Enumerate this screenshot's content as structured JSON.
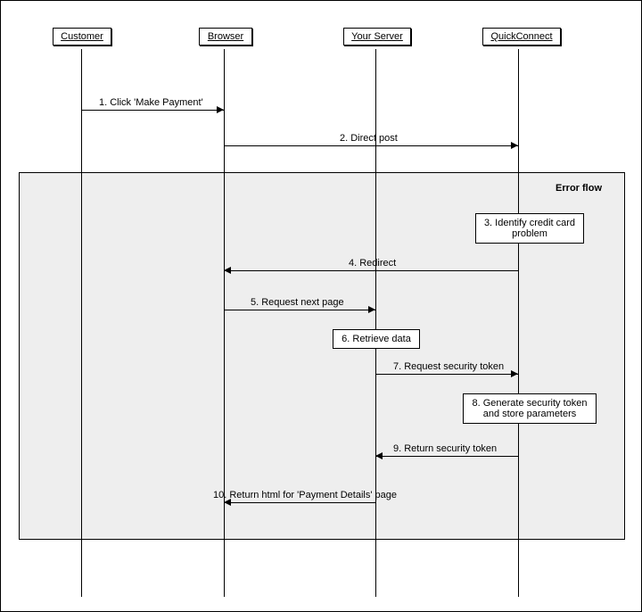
{
  "actors": {
    "customer": "Customer",
    "browser": "Browser",
    "server": "Your Server",
    "quickconnect": "QuickConnect"
  },
  "error_flow_label": "Error flow",
  "messages": {
    "m1": "1. Click 'Make Payment'",
    "m2": "2. Direct post",
    "m4": "4. Redirect",
    "m5": "5. Request next page",
    "m7": "7. Request security token",
    "m9": "9. Return security token",
    "m10": "10. Return html for 'Payment Details' page"
  },
  "notes": {
    "n3": "3. Identify credit card problem",
    "n6": "6. Retrieve data",
    "n8": "8. Generate security token and store parameters"
  },
  "chart_data": {
    "type": "sequence-diagram",
    "participants": [
      "Customer",
      "Browser",
      "Your Server",
      "QuickConnect"
    ],
    "fragments": [
      {
        "type": "box",
        "label": "Error flow",
        "contains_steps": [
          3,
          4,
          5,
          6,
          7,
          8,
          9,
          10
        ]
      }
    ],
    "steps": [
      {
        "n": 1,
        "from": "Customer",
        "to": "Browser",
        "text": "Click 'Make Payment'",
        "kind": "message"
      },
      {
        "n": 2,
        "from": "Browser",
        "to": "QuickConnect",
        "text": "Direct post",
        "kind": "message"
      },
      {
        "n": 3,
        "at": "QuickConnect",
        "text": "Identify credit card problem",
        "kind": "self-action"
      },
      {
        "n": 4,
        "from": "QuickConnect",
        "to": "Browser",
        "text": "Redirect",
        "kind": "message"
      },
      {
        "n": 5,
        "from": "Browser",
        "to": "Your Server",
        "text": "Request next page",
        "kind": "message"
      },
      {
        "n": 6,
        "at": "Your Server",
        "text": "Retrieve data",
        "kind": "self-action"
      },
      {
        "n": 7,
        "from": "Your Server",
        "to": "QuickConnect",
        "text": "Request security token",
        "kind": "message"
      },
      {
        "n": 8,
        "at": "QuickConnect",
        "text": "Generate security token and store parameters",
        "kind": "self-action"
      },
      {
        "n": 9,
        "from": "QuickConnect",
        "to": "Your Server",
        "text": "Return security token",
        "kind": "message"
      },
      {
        "n": 10,
        "from": "Your Server",
        "to": "Browser",
        "text": "Return html for 'Payment Details' page",
        "kind": "message"
      }
    ]
  }
}
